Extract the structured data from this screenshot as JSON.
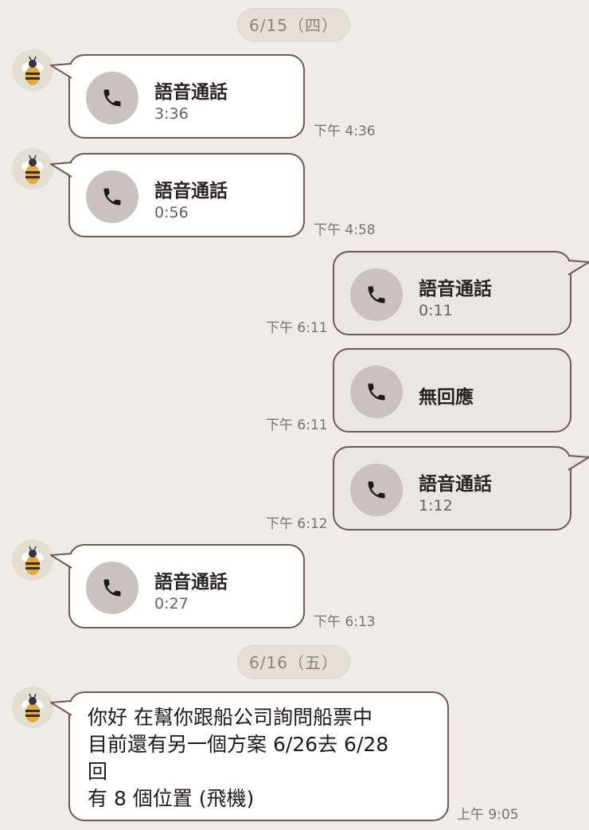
{
  "dates": {
    "d1": "6/15（四）",
    "d2": "6/16（五）"
  },
  "calls": {
    "c1": {
      "title": "語音通話",
      "duration": "3:36",
      "time": "下午 4:36"
    },
    "c2": {
      "title": "語音通話",
      "duration": "0:56",
      "time": "下午 4:58"
    },
    "c3": {
      "title": "語音通話",
      "duration": "0:11",
      "time": "下午 6:11"
    },
    "c4": {
      "title": "無回應",
      "time": "下午 6:11"
    },
    "c5": {
      "title": "語音通話",
      "duration": "1:12",
      "time": "下午 6:12"
    },
    "c6": {
      "title": "語音通話",
      "duration": "0:27",
      "time": "下午 6:13"
    }
  },
  "message": {
    "lines": [
      "你好 在幫你跟船公司詢問船票中",
      "目前還有另一個方案 6/26去 6/28",
      "回",
      "有 8 個位置 (飛機)"
    ],
    "time": "上午 9:05"
  },
  "icons": {
    "avatar": "bee-icon",
    "call": "phone-icon"
  },
  "colors": {
    "background": "#f0ebe6",
    "bubble_border": "#6e5a55",
    "outgoing_bubble": "#ebe6e1",
    "incoming_bubble": "#ffffff"
  }
}
